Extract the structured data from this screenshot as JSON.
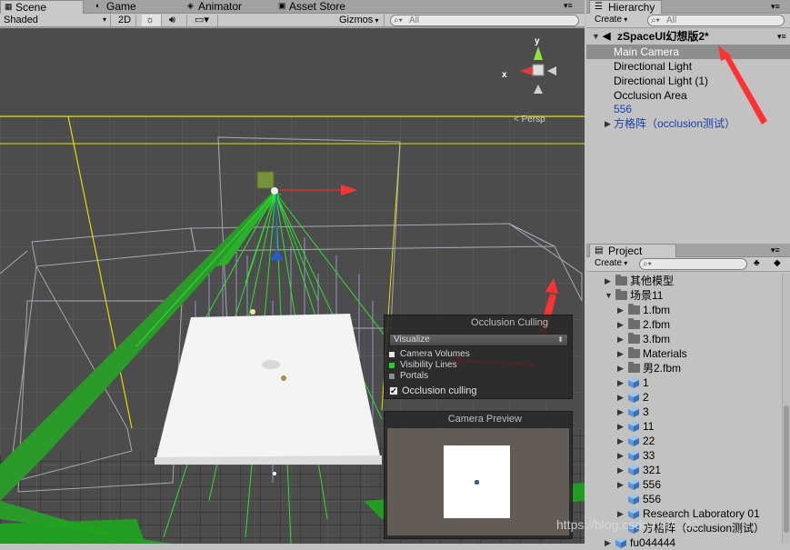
{
  "scene": {
    "tabs": [
      "Scene",
      "Game",
      "Animator",
      "Asset Store"
    ],
    "tab_icons": [
      "scene-icon",
      "game-icon",
      "animator-icon",
      "asset-store-icon"
    ],
    "toolbar": {
      "shading": "Shaded",
      "mode_2d": "2D",
      "gizmos": "Gizmos",
      "search_placeholder": "All"
    },
    "gizmo": {
      "y": "y",
      "x": "x",
      "persp": "< Persp"
    },
    "occlusion": {
      "title": "Occlusion Culling",
      "dropdown": "Visualize",
      "legend": [
        {
          "label": "Camera Volumes",
          "color": "#e8e8e8"
        },
        {
          "label": "Visibility Lines",
          "color": "#1ed21e"
        },
        {
          "label": "Portals",
          "color": "#8c8c8c"
        }
      ],
      "checkbox_label": "Occlusion culling",
      "checked": true
    },
    "camera_preview": {
      "title": "Camera Preview"
    }
  },
  "hierarchy": {
    "title": "Hierarchy",
    "create": "Create",
    "search_placeholder": "All",
    "scene_name": "zSpaceUI幻想版2*",
    "items": [
      {
        "label": "Main Camera",
        "selected": true
      },
      {
        "label": "Directional Light",
        "selected": false
      },
      {
        "label": "Directional Light (1)",
        "selected": false
      },
      {
        "label": "Occlusion Area",
        "selected": false
      },
      {
        "label": "556",
        "selected": false,
        "prefab": true
      },
      {
        "label": "方格阵（occlusion测试）",
        "selected": false,
        "prefab": true,
        "foldout": true
      }
    ]
  },
  "project": {
    "title": "Project",
    "create": "Create",
    "items": [
      {
        "label": "其他模型",
        "kind": "folder",
        "indent": 0,
        "fold": "closed"
      },
      {
        "label": "场景11",
        "kind": "folder",
        "indent": 0,
        "fold": "open"
      },
      {
        "label": "1.fbm",
        "kind": "folder",
        "indent": 1,
        "fold": "closed"
      },
      {
        "label": "2.fbm",
        "kind": "folder",
        "indent": 1,
        "fold": "closed"
      },
      {
        "label": "3.fbm",
        "kind": "folder",
        "indent": 1,
        "fold": "closed"
      },
      {
        "label": "Materials",
        "kind": "folder",
        "indent": 1,
        "fold": "closed"
      },
      {
        "label": "男2.fbm",
        "kind": "folder",
        "indent": 1,
        "fold": "closed"
      },
      {
        "label": "1",
        "kind": "mesh",
        "indent": 1,
        "fold": "closed"
      },
      {
        "label": "2",
        "kind": "mesh",
        "indent": 1,
        "fold": "closed"
      },
      {
        "label": "3",
        "kind": "mesh",
        "indent": 1,
        "fold": "closed"
      },
      {
        "label": "11",
        "kind": "mesh",
        "indent": 1,
        "fold": "closed"
      },
      {
        "label": "22",
        "kind": "mesh",
        "indent": 1,
        "fold": "closed"
      },
      {
        "label": "33",
        "kind": "mesh",
        "indent": 1,
        "fold": "closed"
      },
      {
        "label": "321",
        "kind": "mesh",
        "indent": 1,
        "fold": "closed"
      },
      {
        "label": "556",
        "kind": "mesh",
        "indent": 1,
        "fold": "closed"
      },
      {
        "label": "556",
        "kind": "mesh",
        "indent": 1,
        "fold": "none"
      },
      {
        "label": "Research Laboratory 01",
        "kind": "mesh",
        "indent": 1,
        "fold": "closed"
      },
      {
        "label": "方格阵（occlusion测试）",
        "kind": "mesh",
        "indent": 1,
        "fold": "none"
      },
      {
        "label": "fu044444",
        "kind": "mesh",
        "indent": 0,
        "fold": "closed"
      }
    ]
  },
  "watermark": "https://blog.csdn.net/...32"
}
